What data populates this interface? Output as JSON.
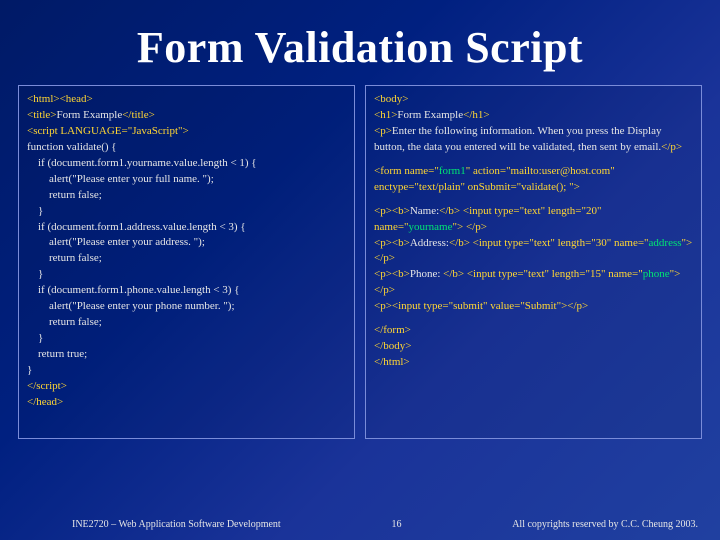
{
  "title": "Form Validation Script",
  "left": {
    "l1a": "<html><head>",
    "l2a": "<title>",
    "l2b": "Form Example",
    "l2c": "</title>",
    "l3a": "<script LANGUAGE=\"JavaScript\">",
    "l4": "function validate() {",
    "l5": "    if (document.form1.yourname.value.length < 1) {",
    "l6": "        alert(\"Please enter your full name. \");",
    "l7": "        return false;",
    "l8": "    }",
    "l9": "    if (document.form1.address.value.length < 3) {",
    "l10": "        alert(\"Please enter your address. \");",
    "l11": "        return false;",
    "l12": "    }",
    "l13": "    if (document.form1.phone.value.length < 3) {",
    "l14": "        alert(\"Please enter your phone number. \");",
    "l15": "        return false;",
    "l16": "    }",
    "l17": "    return true;",
    "l18": "}",
    "l19": "</script>",
    "l20": "</head>"
  },
  "right": {
    "r1": "<body>",
    "r2a": "<h1>",
    "r2b": "Form Example",
    "r2c": "</h1>",
    "r3a": "<p>",
    "r3b": "Enter the following information. When you press the Display button, the data you entered will be validated, then sent by email.",
    "r3c": "</p>",
    "r4a": "<form name=\"",
    "r4b": "form1",
    "r4c": "\" action=\"mailto:user@host.com\" enctype=\"text/plain\" onSubmit=\"validate(); \">",
    "r5a": "<p><b>",
    "r5b": "Name:",
    "r5c": "</b> <input type=\"text\" length=\"20\" name=\"",
    "r5d": "yourname",
    "r5e": "\"> </p>",
    "r6a": "<p><b>",
    "r6b": "Address:",
    "r6c": "</b> <input type=\"text\" length=\"30\" name=\"",
    "r6d": "address",
    "r6e": "\"> </p>",
    "r7a": "<p><b>",
    "r7b": "Phone: ",
    "r7c": "</b> <input type=\"text\" length=\"15\" name=\"",
    "r7d": "phone",
    "r7e": "\"> </p>",
    "r8a": "<p><input type=\"submit\" value=\"Submit\"></p>",
    "r9": "</form>",
    "r10": "</body>",
    "r11": "</html>"
  },
  "footer": {
    "course": "INE2720 – Web Application Software Development",
    "page": "16",
    "copy": "All copyrights reserved by C.C. Cheung 2003."
  }
}
